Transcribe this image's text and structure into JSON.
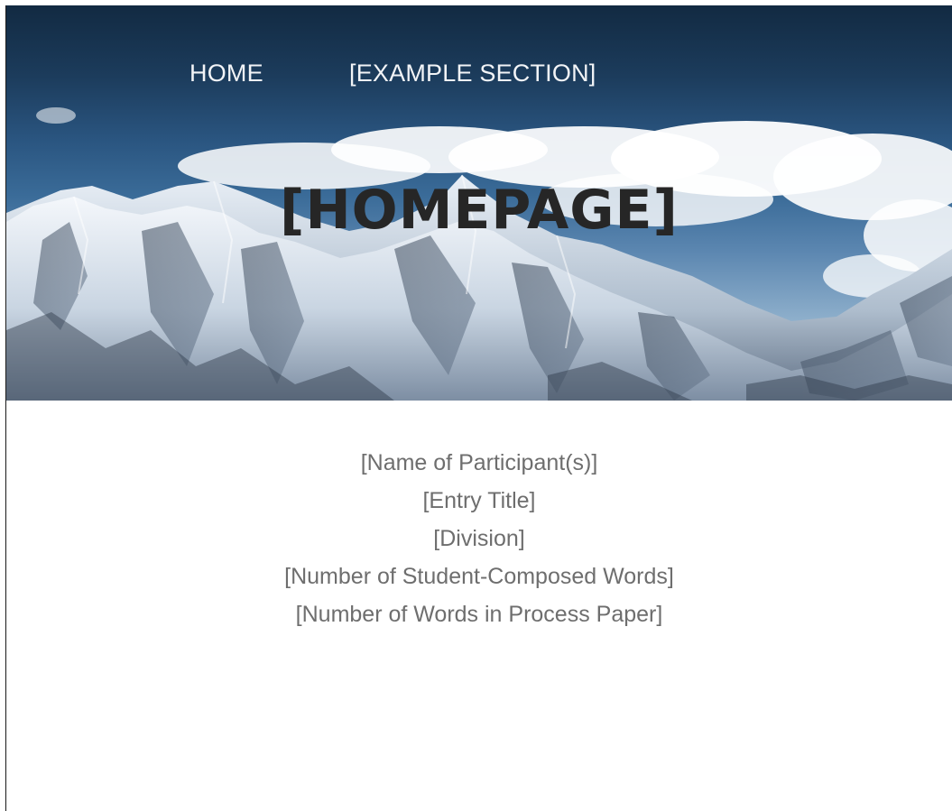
{
  "nav": {
    "home_label": "HOME",
    "section_label": "[EXAMPLE SECTION]"
  },
  "hero": {
    "title": "[HOMEPAGE]"
  },
  "entry_info": {
    "participants": "[Name of Participant(s)]",
    "entry_title": "[Entry Title]",
    "division": "[Division]",
    "student_words": "[Number of Student-Composed Words]",
    "process_paper_words": "[Number of Words in Process Paper]"
  },
  "colors": {
    "nav_text": "#f2f4f7",
    "title_text": "#262626",
    "info_text": "#6e6e6e"
  }
}
